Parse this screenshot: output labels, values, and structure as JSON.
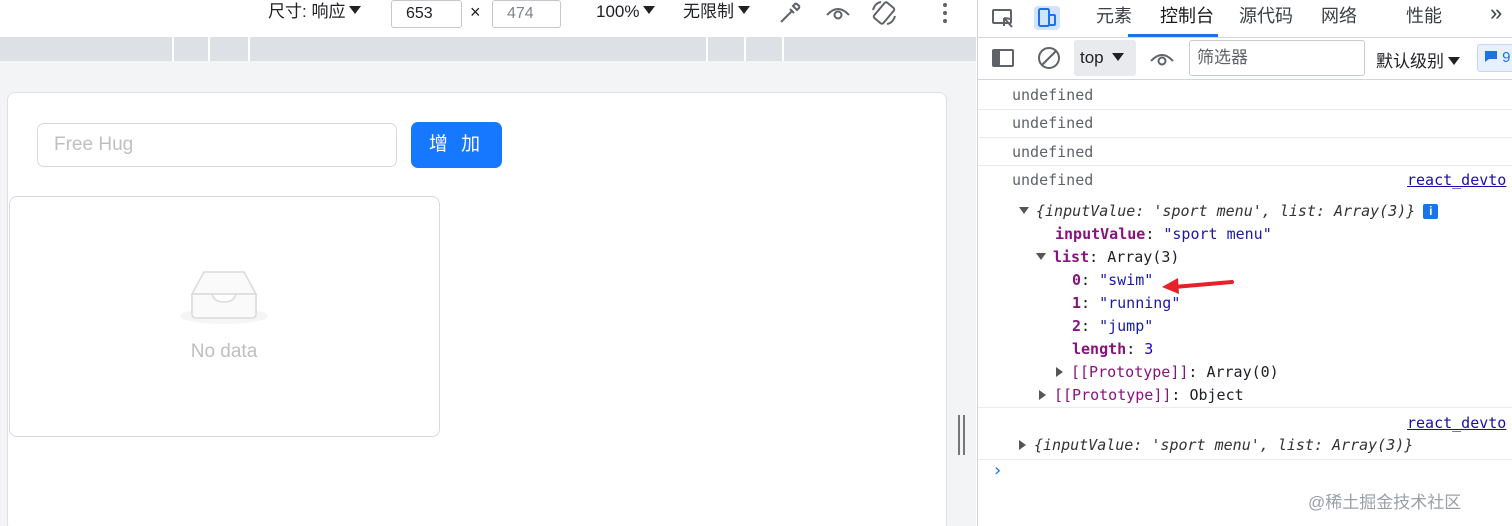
{
  "device_toolbar": {
    "dimensions_label": "尺寸: 响应",
    "width_value": "653",
    "times": "×",
    "height_placeholder": "474",
    "zoom": "100%",
    "throttle": "无限制"
  },
  "app": {
    "input_placeholder": "Free Hug",
    "add_button": "增 加",
    "empty_text": "No data"
  },
  "devtools": {
    "tabs": [
      "元素",
      "控制台",
      "源代码",
      "网络",
      "性能"
    ],
    "active_tab": "控制台",
    "more": "»",
    "context": "top",
    "filter_placeholder": "筛选器",
    "levels": "默认级别",
    "message_count": "9"
  },
  "console": {
    "undefined_lines": [
      "undefined",
      "undefined",
      "undefined",
      "undefined"
    ],
    "source_link": "react_devto",
    "obj_summary_keys": [
      "inputValue",
      "list"
    ],
    "obj_summary": "{inputValue: 'sport menu', list: Array(3)}",
    "obj_summary_open": "{",
    "obj_summary_k1": "inputValue",
    "obj_summary_v1": "'sport menu'",
    "obj_summary_k2": "list",
    "obj_summary_v2": "Array(3)",
    "obj_summary_close": "}",
    "info_badge": "i",
    "input_value_key": "inputValue",
    "input_value": "\"sport menu\"",
    "list_key": "list",
    "list_type": "Array(3)",
    "items": [
      {
        "index": "0",
        "value": "\"swim\""
      },
      {
        "index": "1",
        "value": "\"running\""
      },
      {
        "index": "2",
        "value": "\"jump\""
      }
    ],
    "length_key": "length",
    "length_value": "3",
    "array_proto_key": "[[Prototype]]",
    "array_proto_value": "Array(0)",
    "object_proto_key": "[[Prototype]]",
    "object_proto_value": "Object",
    "prompt": "›"
  },
  "watermark": "@稀土掘金技术社区",
  "colors": {
    "primary": "#1677ff",
    "devtools_accent": "#1a73e8",
    "key": "#881280",
    "string": "#1a1aa6",
    "annotation_arrow": "#e8202a"
  }
}
